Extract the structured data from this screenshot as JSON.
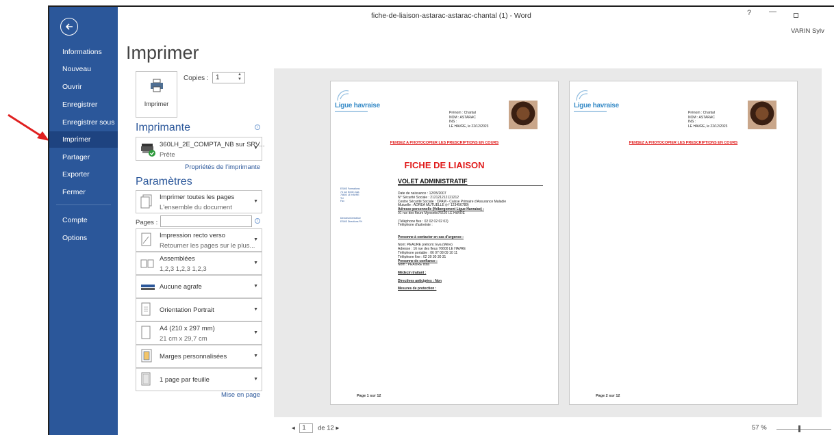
{
  "window": {
    "title": "fiche-de-liaison-astarac-astarac-chantal (1) - Word",
    "user": "VARIN Sylv",
    "help": "?",
    "minimize": "—"
  },
  "sidebar": {
    "items": [
      {
        "label": "Informations"
      },
      {
        "label": "Nouveau"
      },
      {
        "label": "Ouvrir"
      },
      {
        "label": "Enregistrer"
      },
      {
        "label": "Enregistrer sous"
      },
      {
        "label": "Imprimer",
        "active": true
      },
      {
        "label": "Partager"
      },
      {
        "label": "Exporter"
      },
      {
        "label": "Fermer"
      },
      {
        "label": "Compte"
      },
      {
        "label": "Options"
      }
    ]
  },
  "print": {
    "title": "Imprimer",
    "button_label": "Imprimer",
    "copies_label": "Copies :",
    "copies_value": "1"
  },
  "printer": {
    "heading": "Imprimante",
    "name": "360LH_2E_COMPTA_NB sur SRV...",
    "status": "Prête",
    "properties_link": "Propriétés de l'imprimante"
  },
  "settings": {
    "heading": "Paramètres",
    "pages_label": "Pages :",
    "pages_value": "",
    "items": [
      {
        "line1": "Imprimer toutes les pages",
        "line2": "L'ensemble du document"
      },
      {
        "line1": "Impression recto verso",
        "line2": "Retourner les pages sur le plus..."
      },
      {
        "line1": "Assemblées",
        "line2": "1,2,3   1,2,3   1,2,3"
      },
      {
        "line1": "Aucune agrafe",
        "line2": ""
      },
      {
        "line1": "Orientation Portrait",
        "line2": ""
      },
      {
        "line1": "A4 (210 x 297 mm)",
        "line2": "21 cm x 29,7 cm"
      },
      {
        "line1": "Marges personnalisées",
        "line2": ""
      },
      {
        "line1": "1 page par feuille",
        "line2": ""
      }
    ],
    "layout_link": "Mise en page"
  },
  "preview": {
    "logo_text": "Ligue havraise",
    "info_lines": [
      "Prénom : Chantal",
      "NOM : ASTARAC",
      "INS :",
      "LE HAVRE, le 22/12/2023"
    ],
    "warning": "PENSEZ A PHOTOCOPIER LES PRESCRIPTIONS EN COURS",
    "doc_title": "FICHE DE LIAISON",
    "doc_subtitle": "VOLET ADMINISTRATIF",
    "left_block_1": [
      "ESMS Formations",
      "74 rue Emile Zola",
      "76600 LE HAVRE",
      "Tel",
      "Fax"
    ],
    "left_block_2": [
      "Directeur/Directrice",
      "ESMS Directions FH"
    ],
    "body_lines": [
      "Date de naissance : 12/05/2007",
      "N° Sécurité Sociale : 212121212121212",
      "Centre Sécurité Sociale : CPAM - Caisse Primaire d'Assurance Maladie",
      "Mutuelle : ADREA MUTUELLE (n° 123456789)",
      "Adresse personnelle (Hébergement Ligue Havraise) :",
      "01 rue des fleurs  Myosotis76620 LE HAVRE",
      "",
      "(Téléphone fixe : 02 02 02 02 02)",
      "Téléphone d'astreinte :",
      "",
      "",
      "Personne à contacter en cas d'urgence :",
      "",
      "Nom: PEAURE prénom: Eva (Mère)",
      "Adresse : 16 rue des fleus  76600 LE HAVRE",
      "Téléphone portable : 06 07 08 09 10 11",
      "Téléphone fixe : 02 30 30 30 31",
      "Personne de confiance :",
      "Nom : PEAURE Issa",
      "",
      "Médecin traitant :",
      "",
      "Directives anticipées :  Non",
      "",
      "Mesures de protection :"
    ],
    "page1_footer": "Page 1 sur 12",
    "page2_footer": "Page 2 sur 12"
  },
  "footer": {
    "current_page": "1",
    "of_pages": "de 12",
    "zoom": "57 %"
  }
}
